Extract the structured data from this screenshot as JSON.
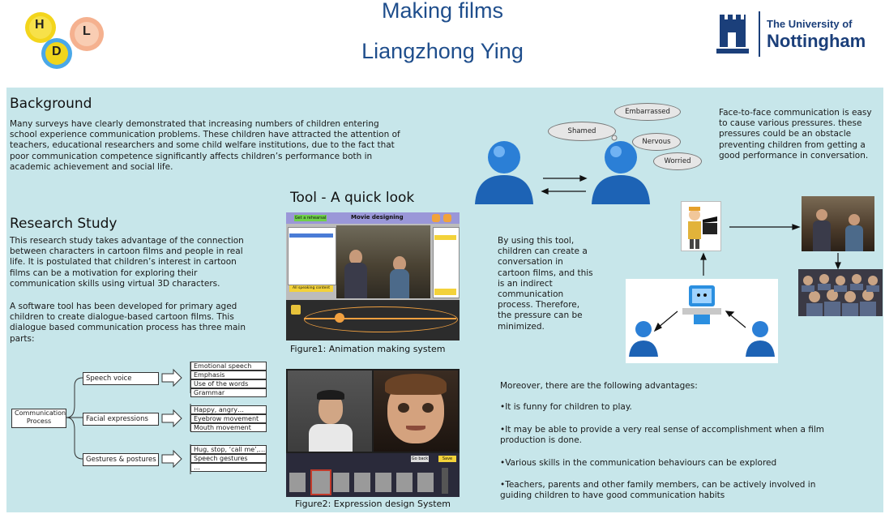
{
  "header": {
    "title": "Making films",
    "author": "Liangzhong Ying",
    "logo_left_letters": [
      "H",
      "L",
      "D"
    ],
    "logo_right_line1": "The University of",
    "logo_right_line2": "Nottingham"
  },
  "background": {
    "heading": "Background",
    "lines": [
      "Many surveys have clearly demonstrated that increasing numbers of children entering",
      "school experience communication problems. These children have attracted the attention of",
      "teachers, educational researchers and some child welfare institutions, due to the fact that",
      "poor communication competence significantly affects children’s performance both in",
      "academic achievement and social life."
    ]
  },
  "research": {
    "heading": "Research Study",
    "para1_lines": [
      "This research study takes advantage of the connection",
      "between characters in cartoon films and people in real",
      "life. It is postulated that children’s interest in cartoon",
      "films can be a motivation for exploring their",
      "communication skills using virtual 3D characters."
    ],
    "para2_lines": [
      "A software tool has been developed for primary aged",
      "children to create dialogue-based cartoon films. This",
      "dialogue based communication process has three main",
      "parts:"
    ]
  },
  "diagram": {
    "root": "Communication Process",
    "branches": [
      {
        "label": "Speech voice",
        "leaves": [
          "Emotional speech",
          "Emphasis",
          "Use of the words",
          "Grammar"
        ]
      },
      {
        "label": "Facial expressions",
        "leaves": [
          "Happy, angry…",
          "Eyebrow movement",
          "Mouth movement"
        ]
      },
      {
        "label": "Gestures & postures",
        "leaves": [
          "Hug, stop, ‘call me’,…",
          "Speech gestures",
          "…"
        ]
      }
    ]
  },
  "tool": {
    "heading": "Tool - A quick look",
    "fig1_caption": "Figure1: Animation making system",
    "fig2_caption": "Figure2: Expression design System",
    "fig1_title": "Movie designing",
    "fig1_button": "Get a rehearsal",
    "fig1_bottom_button": "All speaking content",
    "fig2_button": "Go back",
    "fig2_button2": "Save"
  },
  "pressure": {
    "clouds": [
      "Embarrassed",
      "Shamed",
      "Nervous",
      "Worried"
    ],
    "text_lines": [
      "Face-to-face communication is easy",
      "to cause various pressures. these",
      "pressures could be an obstacle",
      "preventing children from getting a",
      "good performance in conversation."
    ]
  },
  "tool_use": {
    "text_lines": [
      "By using this tool,",
      "children can create a",
      "conversation in",
      "cartoon films, and this",
      "is an indirect",
      "communication",
      "process. Therefore,",
      "the pressure can be",
      "minimized."
    ]
  },
  "advantages": {
    "intro": "Moreover, there are the following advantages:",
    "items": [
      {
        "lines": [
          "•It is funny for children to play."
        ]
      },
      {
        "lines": [
          "•It may be able to provide a very real sense of accomplishment when a film",
          "production is done."
        ]
      },
      {
        "lines": [
          "•Various skills in the communication behaviours can be explored"
        ]
      },
      {
        "lines": [
          "•Teachers, parents and other family members, can be actively involved in",
          "guiding children to have good communication habits"
        ]
      }
    ]
  },
  "colors": {
    "title_blue": "#1f4e8c",
    "panel_bg": "#c7e6ea",
    "nottingham_blue": "#1b3f7a"
  }
}
